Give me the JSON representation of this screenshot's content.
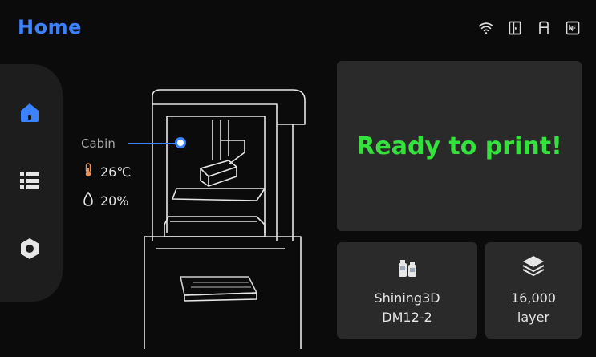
{
  "header": {
    "title": "Home",
    "status_icons": [
      "wifi-icon",
      "door-icon",
      "printer-lid-icon",
      "nfc-icon"
    ]
  },
  "sidebar": {
    "items": [
      {
        "name": "home",
        "icon": "home-icon",
        "active": true
      },
      {
        "name": "list",
        "icon": "list-icon",
        "active": false
      },
      {
        "name": "settings",
        "icon": "gear-icon",
        "active": false
      }
    ]
  },
  "cabin": {
    "label": "Cabin",
    "temperature": "26℃",
    "humidity": "20%"
  },
  "status": {
    "text": "Ready to print!"
  },
  "material": {
    "icon": "resin-bottles-icon",
    "line1": "Shining3D",
    "line2": "DM12-2"
  },
  "layers": {
    "icon": "layers-icon",
    "line1": "16,000",
    "line2": "layer"
  },
  "colors": {
    "accent": "#3b82ff",
    "ready": "#35e13c",
    "card": "#2a2a2a",
    "background": "#0b0b0b"
  }
}
